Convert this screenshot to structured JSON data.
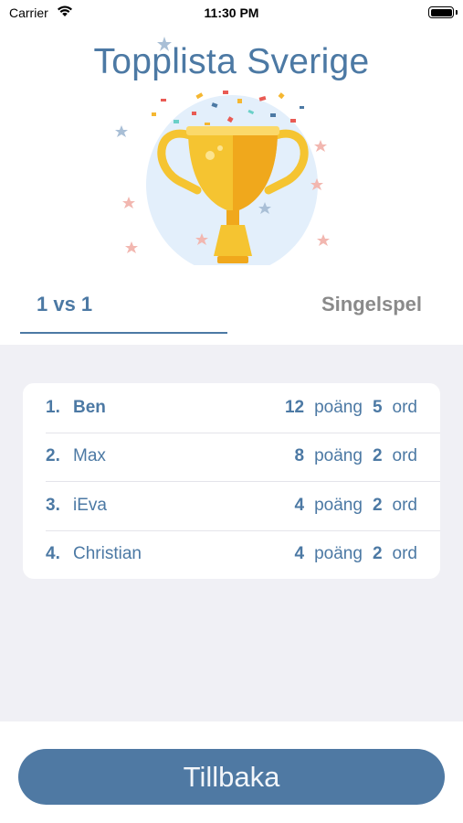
{
  "status_bar": {
    "carrier": "Carrier",
    "time": "11:30 PM",
    "icons": [
      "wifi-icon",
      "battery-icon"
    ]
  },
  "header": {
    "title": "Topplista Sverige",
    "illustration": "trophy-icon"
  },
  "tabs": [
    {
      "label": "1 vs 1",
      "selected": true
    },
    {
      "label": "Singelspel",
      "selected": false
    }
  ],
  "leaderboard": {
    "points_unit": "poäng",
    "words_unit": "ord",
    "rows": [
      {
        "rank": "1.",
        "name": "Ben",
        "points": "12",
        "words": "5"
      },
      {
        "rank": "2.",
        "name": "Max",
        "points": "8",
        "words": "2"
      },
      {
        "rank": "3.",
        "name": "iEva",
        "points": "4",
        "words": "2"
      },
      {
        "rank": "4.",
        "name": "Christian",
        "points": "4",
        "words": "2"
      }
    ]
  },
  "footer": {
    "back_label": "Tillbaka"
  },
  "colors": {
    "accent": "#4c79a4",
    "button": "#4f79a3",
    "list_background": "#f0f0f5",
    "inactive_tab": "#8a8a8a"
  }
}
